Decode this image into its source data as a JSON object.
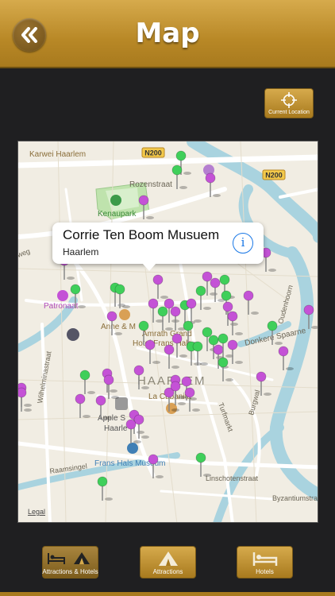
{
  "header": {
    "title": "Map",
    "back_icon": "double-chevron-left-icon"
  },
  "current_location": {
    "label": "Current Location",
    "icon": "crosshair-icon"
  },
  "map": {
    "streets": [
      "Karwei Haarlem",
      "N200",
      "N200",
      "Rozenstraat",
      "Kenaupark",
      "Patronaat",
      "Anne & M",
      "Amrath Grand",
      "Hotel Frans Hals",
      "HAARLEM",
      "La Cubanita",
      "Apple S",
      "Haarle",
      "Wilhelminastraat",
      "Raamsingel",
      "Frans Hals Museum",
      "Linschotenstraat",
      "Turfmarkt",
      "Donkere Spaarne",
      "Oudenhoorn",
      "Burgwal",
      "Byzantiumstraat",
      "weg",
      "Legal"
    ],
    "callout": {
      "title": "Corrie Ten Boom Musuem",
      "subtitle": "Haarlem",
      "icon": "info-icon"
    }
  },
  "tabs": [
    {
      "label": "Attractions & Hotels",
      "icon": "bed-and-tent-icon",
      "active": true
    },
    {
      "label": "Attractions",
      "icon": "tent-icon",
      "active": false
    },
    {
      "label": "Hotels",
      "icon": "bed-icon",
      "active": false
    }
  ],
  "colors": {
    "gold": "#b88826",
    "pin_purple": "#c452d6",
    "pin_green": "#3fcf5a",
    "water": "#a9d3df"
  }
}
